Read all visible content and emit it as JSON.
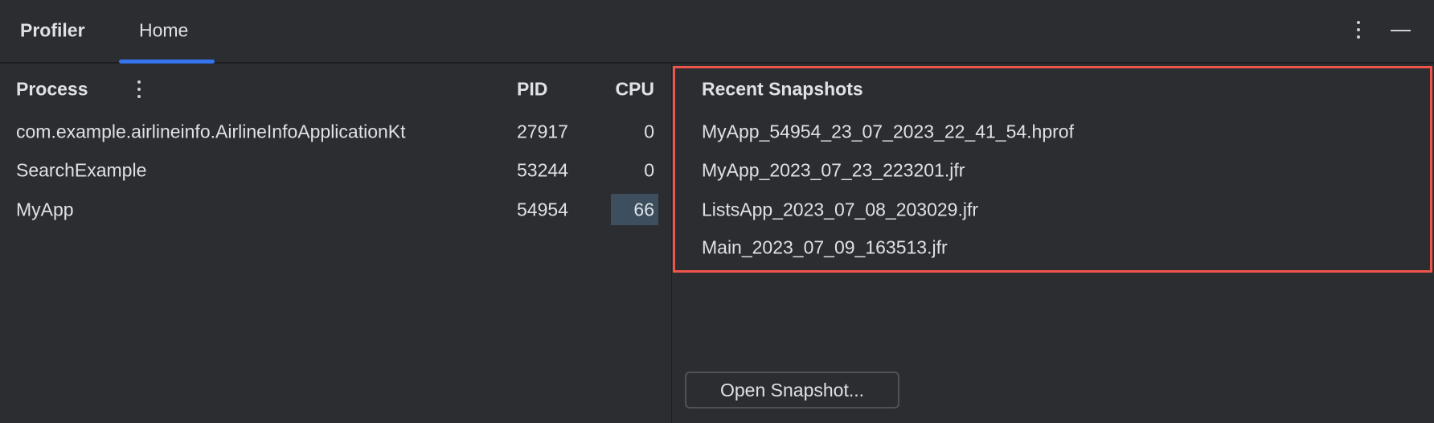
{
  "header": {
    "title": "Profiler",
    "tabs": [
      {
        "label": "Home",
        "active": true
      }
    ]
  },
  "process_table": {
    "columns": [
      "Process",
      "PID",
      "CPU"
    ],
    "rows": [
      {
        "process": "com.example.airlineinfo.AirlineInfoApplicationKt",
        "pid": "27917",
        "cpu": "0"
      },
      {
        "process": "SearchExample",
        "pid": "53244",
        "cpu": "0"
      },
      {
        "process": "MyApp",
        "pid": "54954",
        "cpu": "66",
        "highlighted": true
      }
    ]
  },
  "recent_snapshots": {
    "title": "Recent Snapshots",
    "items": [
      "MyApp_54954_23_07_2023_22_41_54.hprof",
      "MyApp_2023_07_23_223201.jfr",
      "ListsApp_2023_07_08_203029.jfr",
      "Main_2023_07_09_163513.jfr"
    ],
    "open_button": "Open Snapshot..."
  },
  "colors": {
    "accent": "#3574f0",
    "highlight_box": "#f0554b",
    "background": "#2b2d30"
  }
}
